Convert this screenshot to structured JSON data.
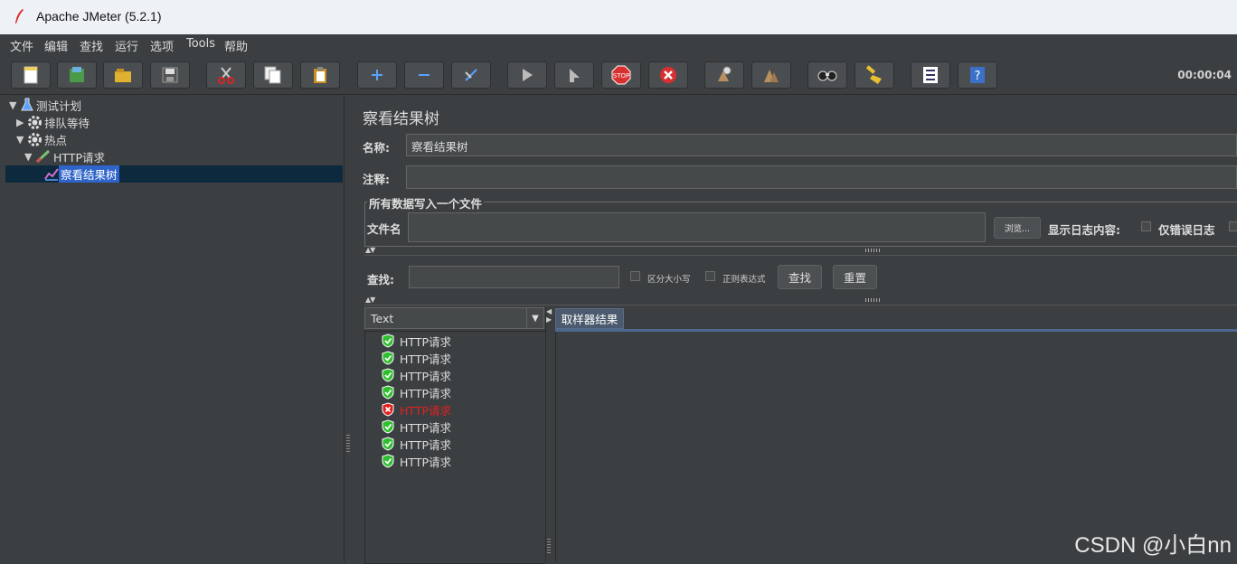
{
  "window": {
    "title": "Apache JMeter (5.2.1)"
  },
  "menu": [
    "文件",
    "编辑",
    "查找",
    "运行",
    "选项",
    "Tools",
    "帮助"
  ],
  "toolbar": {
    "buttons": [
      "new-icon",
      "templates-icon",
      "open-icon",
      "save-icon",
      "cut-icon",
      "copy-icon",
      "paste-icon",
      "expand-icon",
      "collapse-icon",
      "toggle-icon",
      "start-icon",
      "start-no-pause-icon",
      "stop-icon",
      "shutdown-icon",
      "clear-icon",
      "clear-all-icon",
      "search-icon",
      "reset-search-icon",
      "function-helper-icon",
      "help-icon"
    ],
    "timer": "00:00:04"
  },
  "tree": {
    "items": [
      {
        "label": "测试计划",
        "level": 0,
        "expanded": true
      },
      {
        "label": "排队等待",
        "level": 1,
        "expanded": false
      },
      {
        "label": "热点",
        "level": 1,
        "expanded": true
      },
      {
        "label": "HTTP请求",
        "level": 2,
        "expanded": true
      },
      {
        "label": "察看结果树",
        "level": 3,
        "selected": true
      }
    ]
  },
  "panel": {
    "heading": "察看结果树",
    "name_label": "名称:",
    "name_value": "察看结果树",
    "comment_label": "注释:",
    "comment_value": "",
    "file_group_title": "所有数据写入一个文件",
    "filename_label": "文件名",
    "browse_label": "浏览...",
    "log_label": "显示日志内容:",
    "errors_only_label": "仅错误日志",
    "search_label": "查找:",
    "case_sensitive_label": "区分大小写",
    "regex_label": "正则表达式",
    "search_button": "查找",
    "reset_button": "重置"
  },
  "results": {
    "renderer": "Text",
    "samples": [
      {
        "label": "HTTP请求",
        "status": "success"
      },
      {
        "label": "HTTP请求",
        "status": "success"
      },
      {
        "label": "HTTP请求",
        "status": "success"
      },
      {
        "label": "HTTP请求",
        "status": "success"
      },
      {
        "label": "HTTP请求",
        "status": "error"
      },
      {
        "label": "HTTP请求",
        "status": "success"
      },
      {
        "label": "HTTP请求",
        "status": "success"
      },
      {
        "label": "HTTP请求",
        "status": "success"
      }
    ],
    "tab_label": "取样器结果"
  },
  "watermark": "CSDN @小白nn",
  "colors": {
    "success": "#2fbf2f",
    "error": "#e02020",
    "selection": "#2f65ca"
  }
}
